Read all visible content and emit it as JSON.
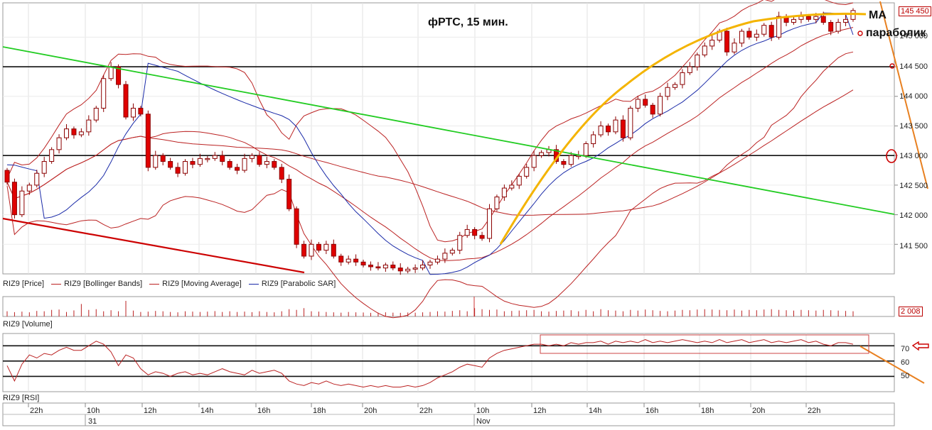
{
  "chart_data": {
    "type": "candlestick",
    "title": "фРТС,  15 мин.",
    "annotations": {
      "ma": "MA",
      "parabolic": "параболик"
    },
    "legend": [
      {
        "label": "RIZ9 [Price]"
      },
      {
        "label": "RIZ9 [Bollinger Bands]"
      },
      {
        "label": "RIZ9 [Moving Average]"
      },
      {
        "label": "RIZ9 [Parabolic SAR]"
      }
    ],
    "price_axis": {
      "ticks": [
        "145 000",
        "144 500",
        "144 000",
        "143 500",
        "143 000",
        "142 500",
        "142 000",
        "141 500"
      ],
      "last_price": "145 450",
      "ylim": [
        141000,
        145580
      ],
      "levels": [
        144500,
        143000
      ]
    },
    "volume_panel": {
      "label": "RIZ9 [Volume]",
      "last_value": "2 008"
    },
    "rsi_panel": {
      "label": "RIZ9 [RSI]",
      "ticks": [
        "70",
        "60",
        "50"
      ],
      "levels": [
        70,
        60,
        50
      ],
      "ylim": [
        40,
        78
      ]
    },
    "x_axis": {
      "time_labels": [
        "22h",
        "10h",
        "12h",
        "14h",
        "16h",
        "18h",
        "20h",
        "22h",
        "10h",
        "12h",
        "14h",
        "16h",
        "18h",
        "20h",
        "22h"
      ],
      "date_labels": [
        "31",
        "Nov"
      ]
    },
    "series": [
      {
        "name": "RIZ9 [Price]",
        "role": "close",
        "values": [
          142550,
          142000,
          142400,
          142500,
          142700,
          142900,
          143100,
          143300,
          143450,
          143350,
          143400,
          143600,
          143800,
          144300,
          144500,
          144200,
          143650,
          143800,
          143700,
          142800,
          143000,
          142900,
          142800,
          142700,
          142900,
          142850,
          142950,
          142950,
          143000,
          142900,
          142800,
          142750,
          142950,
          143000,
          142850,
          142900,
          142800,
          142600,
          142100,
          141500,
          141300,
          141500,
          141400,
          141500,
          141300,
          141200,
          141250,
          141200,
          141150,
          141120,
          141100,
          141150,
          141100,
          141050,
          141080,
          141100,
          141150,
          141200,
          141250,
          141350,
          141400,
          141650,
          141750,
          141650,
          141600,
          142100,
          142300,
          142450,
          142500,
          142650,
          142800,
          143000,
          143050,
          143100,
          142900,
          142850,
          143000,
          143000,
          143200,
          143350,
          143500,
          143400,
          143600,
          143300,
          143800,
          143950,
          143850,
          143700,
          144000,
          144150,
          144200,
          144400,
          144500,
          144700,
          144850,
          144950,
          145100,
          144750,
          144900,
          145100,
          145000,
          145050,
          145200,
          145000,
          145350,
          145250,
          145300,
          145350,
          145300,
          145350,
          145250,
          145100,
          145250,
          145300,
          145450
        ]
      },
      {
        "name": "RIZ9 [Volume]",
        "role": "volume",
        "values": [
          300,
          250,
          280,
          240,
          320,
          300,
          380,
          400,
          260,
          350,
          720,
          380,
          420,
          300,
          360,
          300,
          900,
          340,
          260,
          280,
          320,
          300,
          260,
          240,
          300,
          280,
          260,
          280,
          310,
          260,
          300,
          260,
          280,
          250,
          300,
          260,
          240,
          300,
          420,
          380,
          480,
          300,
          280,
          260,
          240,
          220,
          260,
          240,
          230,
          210,
          220,
          240,
          220,
          210,
          230,
          220,
          240,
          260,
          300,
          280,
          320,
          360,
          300,
          480,
          420,
          380,
          400,
          300,
          320,
          340,
          360,
          380,
          300,
          280,
          320,
          340,
          360,
          300,
          380,
          300,
          420,
          360,
          340,
          300,
          380,
          340,
          400,
          360,
          320,
          300,
          340,
          380,
          360,
          400,
          420,
          400,
          380,
          360,
          400,
          340,
          380,
          360,
          400,
          420,
          380,
          360,
          340,
          380,
          360,
          340,
          380,
          360,
          340,
          320,
          300
        ]
      },
      {
        "name": "RIZ9 [RSI]",
        "role": "rsi",
        "values": [
          57,
          47,
          58,
          64,
          62,
          65,
          64,
          67,
          69,
          67,
          67,
          70,
          73,
          71,
          66,
          57,
          64,
          62,
          55,
          51,
          53,
          52,
          50,
          52,
          53,
          51,
          52,
          51,
          53,
          55,
          53,
          52,
          51,
          54,
          52,
          53,
          54,
          52,
          47,
          45,
          44,
          46,
          45,
          47,
          45,
          44,
          45,
          44,
          43,
          44,
          43,
          44,
          43,
          43,
          44,
          43,
          44,
          46,
          49,
          51,
          53,
          56,
          58,
          57,
          56,
          62,
          65,
          67,
          68,
          69,
          70,
          71,
          71,
          70,
          71,
          70,
          72,
          71,
          72,
          72,
          73,
          71,
          73,
          72,
          73,
          72,
          74,
          72,
          73,
          72,
          73,
          74,
          73,
          72,
          73,
          72,
          74,
          72,
          73,
          74,
          72,
          73,
          74,
          72,
          73,
          72,
          73,
          74,
          72,
          73,
          71,
          70,
          72,
          72,
          71
        ]
      }
    ]
  }
}
